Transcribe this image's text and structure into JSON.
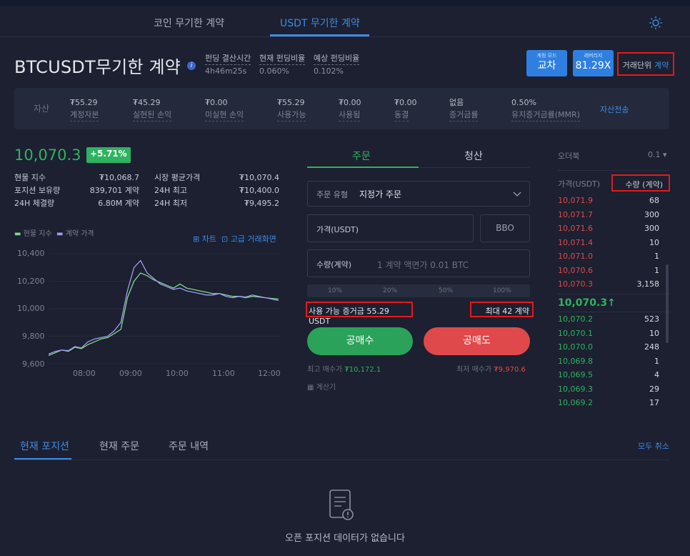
{
  "tabs": {
    "coin": "코인 무기한 계약",
    "usdt": "USDT 무기한 계약"
  },
  "header": {
    "title": "BTCUSDT무기한 계약",
    "info": "i",
    "funding": [
      {
        "label": "펀딩 결산시간",
        "value": "4h46m25s"
      },
      {
        "label": "현재 펀딩비율",
        "value": "0.060%"
      },
      {
        "label": "예상 펀딩비율",
        "value": "0.102%"
      }
    ],
    "mode": {
      "small": "계정 모드",
      "value": "교차"
    },
    "leverage": {
      "small": "레버리지",
      "value": "81.29X"
    },
    "unit": {
      "label": "거래단위",
      "value": "계약"
    }
  },
  "assets": {
    "label": "자산",
    "items": [
      {
        "v": "₮55.29",
        "k": "계정자본"
      },
      {
        "v": "₮45.29",
        "k": "실현된 손익"
      },
      {
        "v": "₮0.00",
        "k": "미실현 손익"
      },
      {
        "v": "₮55.29",
        "k": "사용가능"
      },
      {
        "v": "₮0.00",
        "k": "사용됨"
      },
      {
        "v": "₮0.00",
        "k": "동결"
      },
      {
        "v": "없음",
        "k": "증거금률"
      },
      {
        "v": "0.50%",
        "k": "유지증거금률(MMR)"
      }
    ],
    "transfer": "자산전송"
  },
  "ticker": {
    "price": "10,070.3",
    "change": "+5.71%",
    "stats": [
      [
        "현물 지수",
        "₮10,068.7",
        "시장 평균가격",
        "₮10,070.4"
      ],
      [
        "포지션 보유량",
        "839,701 계약",
        "24H 최고",
        "₮10,400.0"
      ],
      [
        "24H 체결량",
        "6.80M 계약",
        "24H 최저",
        "₮9,495.2"
      ]
    ]
  },
  "chart": {
    "legend_spot": "현물 지수",
    "legend_contract": "계약 가격",
    "link_chart": "차트",
    "link_adv": "고급 거래화면",
    "colors": {
      "spot": "#7fd88e",
      "contract": "#a29cf4"
    }
  },
  "chart_data": {
    "type": "line",
    "y_ticks": [
      "10,400",
      "10,200",
      "10,000",
      "9,800",
      "9,600"
    ],
    "x_ticks": [
      "08:00",
      "09:00",
      "10:00",
      "11:00",
      "12:00"
    ],
    "ylim": [
      9600,
      10400
    ],
    "series": [
      {
        "name": "현물 지수",
        "values": [
          9660,
          9680,
          9700,
          9690,
          9720,
          9710,
          9740,
          9760,
          9780,
          9790,
          9820,
          9850,
          10080,
          10200,
          10260,
          10240,
          10210,
          10190,
          10170,
          10150,
          10180,
          10150,
          10140,
          10130,
          10120,
          10110,
          10110,
          10100,
          10090,
          10090,
          10080,
          10090,
          10085,
          10080,
          10075,
          10070
        ]
      },
      {
        "name": "계약 가격",
        "values": [
          9670,
          9690,
          9700,
          9695,
          9725,
          9715,
          9760,
          9780,
          9790,
          9800,
          9840,
          9900,
          10130,
          10300,
          10350,
          10260,
          10220,
          10180,
          10160,
          10140,
          10150,
          10130,
          10120,
          10110,
          10100,
          10100,
          10110,
          10090,
          10080,
          10090,
          10085,
          10100,
          10090,
          10080,
          10070,
          10060
        ]
      }
    ]
  },
  "order": {
    "tab_order": "주문",
    "tab_close": "청산",
    "type_label": "주문 유형",
    "type_value": "지정가 주문",
    "price_label": "가격(USDT)",
    "bbo": "BBO",
    "qty_label": "수량(계약)",
    "qty_placeholder": "1 계약 액면가 0.01 BTC",
    "slider": [
      "10%",
      "20%",
      "50%",
      "100%"
    ],
    "available": "사용 가능 증거금 55.29 USDT",
    "max": "최대 42 계약",
    "buy": "공매수",
    "sell": "공매도",
    "min_buy_label": "최고 매수가",
    "min_buy": "₮10,172.1",
    "max_sell_label": "최저 매수가",
    "max_sell": "₮9,970.6",
    "calc": "계산기"
  },
  "orderbook": {
    "title": "오더북",
    "depth": "0.1",
    "col_price": "가격(USDT)",
    "col_qty": "수량 (계약)",
    "asks": [
      [
        "10,071.9",
        "68"
      ],
      [
        "10,071.7",
        "300"
      ],
      [
        "10,071.6",
        "300"
      ],
      [
        "10,071.4",
        "10"
      ],
      [
        "10,071.0",
        "1"
      ],
      [
        "10,070.6",
        "1"
      ],
      [
        "10,070.3",
        "3,158"
      ]
    ],
    "mid": "10,070.3↑",
    "bids": [
      [
        "10,070.2",
        "523"
      ],
      [
        "10,070.1",
        "10"
      ],
      [
        "10,070.0",
        "248"
      ],
      [
        "10,069.8",
        "1"
      ],
      [
        "10,069.5",
        "4"
      ],
      [
        "10,069.3",
        "29"
      ],
      [
        "10,069.2",
        "17"
      ]
    ]
  },
  "bottom": {
    "tabs": [
      "현재 포지션",
      "현재 주문",
      "주문 내역"
    ],
    "cancel_all": "모두 취소",
    "empty": "오픈 포지션 데이터가 없습니다"
  }
}
